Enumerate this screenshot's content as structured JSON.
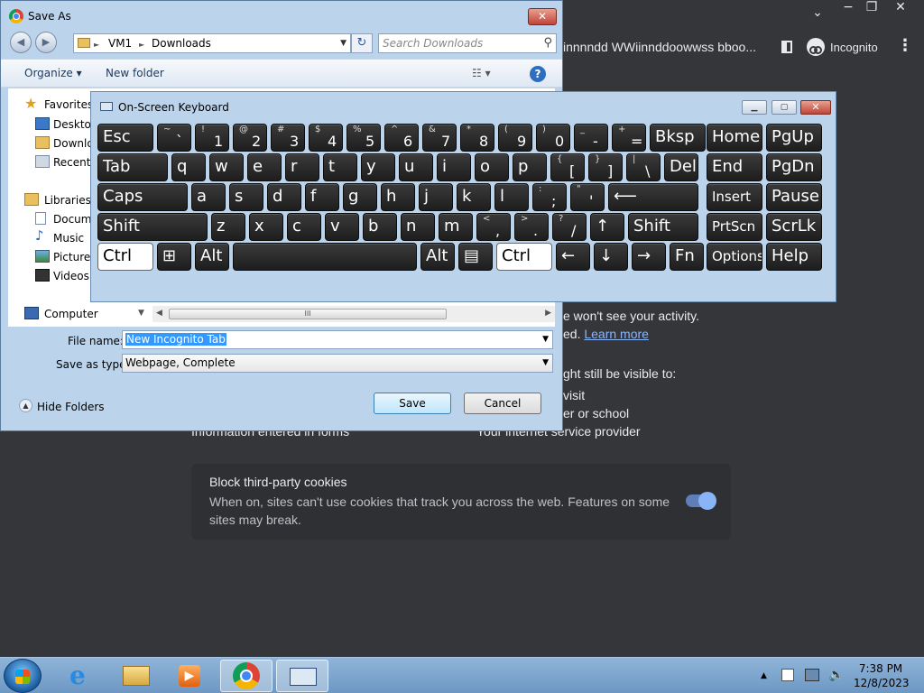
{
  "chrome": {
    "tab_title": "innnndd WWiinnddoowwss bboo...",
    "incognito_label": "Incognito",
    "wont_see": "e won't see your activity.",
    "learn_prefix": "ed. ",
    "learn_more": "Learn more",
    "visible_to": "ght still be visible to:",
    "bullet_visit": "visit",
    "bullet_school": "er or school",
    "bullet_forms": "Information entered in forms",
    "bullet_isp": "Your internet service provider",
    "cookie_title": "Block third-party cookies",
    "cookie_desc": "When on, sites can't use cookies that track you across the web. Features on some sites may break.",
    "win_min": "⌄",
    "win_restore": "−",
    "win_max": "❐",
    "win_close": "✕",
    "menu_dots": "⋮"
  },
  "save_dialog": {
    "title": "Save As",
    "close": "✕",
    "breadcrumb": [
      "VM1",
      "Downloads"
    ],
    "breadcrumb_sep": "►",
    "search_placeholder": "Search Downloads",
    "organize": "Organize ▾",
    "new_folder": "New folder",
    "nav": {
      "favorites": "Favorites",
      "desktop": "Desktop",
      "downloads": "Downlo",
      "recent": "Recent P",
      "libraries": "Libraries",
      "documents": "Docume",
      "music": "Music",
      "pictures": "Pictures",
      "videos": "Videos",
      "computer": "Computer"
    },
    "file_name_label": "File name:",
    "file_name_value": "New Incognito Tab",
    "save_type_label": "Save as type:",
    "save_type_value": "Webpage, Complete",
    "hide_folders": "Hide Folders",
    "save_button": "Save",
    "cancel_button": "Cancel"
  },
  "osk": {
    "title": "On-Screen Keyboard",
    "rows": [
      [
        {
          "main": "Esc"
        },
        {
          "top": "~",
          "bot": "`"
        },
        {
          "top": "!",
          "bot": "1"
        },
        {
          "top": "@",
          "bot": "2"
        },
        {
          "top": "#",
          "bot": "3"
        },
        {
          "top": "$",
          "bot": "4"
        },
        {
          "top": "%",
          "bot": "5"
        },
        {
          "top": "^",
          "bot": "6"
        },
        {
          "top": "&",
          "bot": "7"
        },
        {
          "top": "*",
          "bot": "8"
        },
        {
          "top": "(",
          "bot": "9"
        },
        {
          "top": ")",
          "bot": "0"
        },
        {
          "top": "_",
          "bot": "-"
        },
        {
          "top": "+",
          "bot": "="
        },
        {
          "main": "Bksp"
        },
        {
          "main": "Home"
        },
        {
          "main": "PgUp"
        }
      ],
      [
        {
          "main": "Tab"
        },
        {
          "main": "q"
        },
        {
          "main": "w"
        },
        {
          "main": "e"
        },
        {
          "main": "r"
        },
        {
          "main": "t"
        },
        {
          "main": "y"
        },
        {
          "main": "u"
        },
        {
          "main": "i"
        },
        {
          "main": "o"
        },
        {
          "main": "p"
        },
        {
          "top": "{",
          "bot": "["
        },
        {
          "top": "}",
          "bot": "]"
        },
        {
          "top": "|",
          "bot": "\\"
        },
        {
          "main": "Del"
        },
        {
          "main": "End"
        },
        {
          "main": "PgDn"
        }
      ],
      [
        {
          "main": "Caps"
        },
        {
          "main": "a"
        },
        {
          "main": "s"
        },
        {
          "main": "d"
        },
        {
          "main": "f"
        },
        {
          "main": "g"
        },
        {
          "main": "h"
        },
        {
          "main": "j"
        },
        {
          "main": "k"
        },
        {
          "main": "l"
        },
        {
          "top": ":",
          "bot": ";"
        },
        {
          "top": "\"",
          "bot": "'"
        },
        {
          "main": "⟵"
        },
        {
          "main": "Insert"
        },
        {
          "main": "Pause"
        }
      ],
      [
        {
          "main": "Shift"
        },
        {
          "main": "z"
        },
        {
          "main": "x"
        },
        {
          "main": "c"
        },
        {
          "main": "v"
        },
        {
          "main": "b"
        },
        {
          "main": "n"
        },
        {
          "main": "m"
        },
        {
          "top": "<",
          "bot": ","
        },
        {
          "top": ">",
          "bot": "."
        },
        {
          "top": "?",
          "bot": "/"
        },
        {
          "main": "↑"
        },
        {
          "main": "Shift"
        },
        {
          "main": "PrtScn"
        },
        {
          "main": "ScrLk"
        }
      ],
      [
        {
          "main": "Ctrl"
        },
        {
          "main": "⊞"
        },
        {
          "main": "Alt"
        },
        {
          "main": ""
        },
        {
          "main": "Alt"
        },
        {
          "main": "▤"
        },
        {
          "main": "Ctrl"
        },
        {
          "main": "←"
        },
        {
          "main": "↓"
        },
        {
          "main": "→"
        },
        {
          "main": "Fn"
        },
        {
          "main": "Options"
        },
        {
          "main": "Help"
        }
      ]
    ]
  },
  "taskbar": {
    "time": "7:38 PM",
    "date": "12/8/2023",
    "tray_arrow": "▲"
  }
}
